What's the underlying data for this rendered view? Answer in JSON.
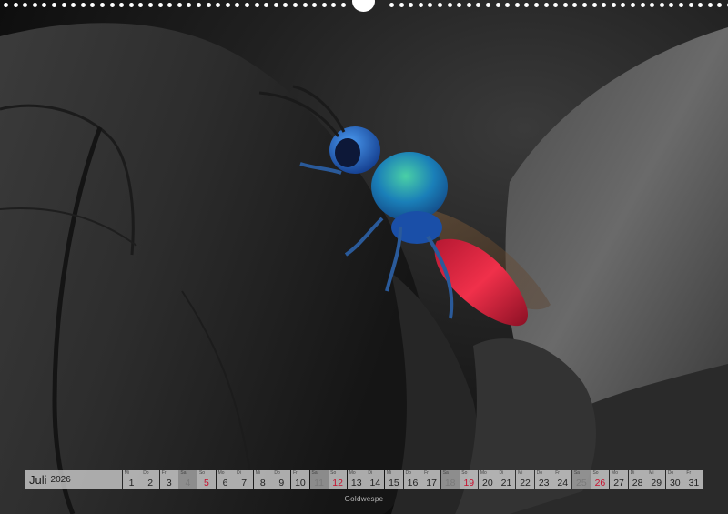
{
  "calendar": {
    "month": "Juli",
    "year": "2026",
    "days": [
      {
        "num": "1",
        "wd": "Mi",
        "type": "normal"
      },
      {
        "num": "2",
        "wd": "Do",
        "type": "normal"
      },
      {
        "num": "3",
        "wd": "Fr",
        "type": "normal"
      },
      {
        "num": "4",
        "wd": "Sa",
        "type": "dim"
      },
      {
        "num": "5",
        "wd": "So",
        "type": "holiday"
      },
      {
        "num": "6",
        "wd": "Mo",
        "type": "normal"
      },
      {
        "num": "7",
        "wd": "Di",
        "type": "normal"
      },
      {
        "num": "8",
        "wd": "Mi",
        "type": "normal"
      },
      {
        "num": "9",
        "wd": "Do",
        "type": "normal"
      },
      {
        "num": "10",
        "wd": "Fr",
        "type": "normal"
      },
      {
        "num": "11",
        "wd": "Sa",
        "type": "dim"
      },
      {
        "num": "12",
        "wd": "So",
        "type": "holiday"
      },
      {
        "num": "13",
        "wd": "Mo",
        "type": "normal"
      },
      {
        "num": "14",
        "wd": "Di",
        "type": "normal"
      },
      {
        "num": "15",
        "wd": "Mi",
        "type": "normal"
      },
      {
        "num": "16",
        "wd": "Do",
        "type": "normal"
      },
      {
        "num": "17",
        "wd": "Fr",
        "type": "normal"
      },
      {
        "num": "18",
        "wd": "Sa",
        "type": "dim"
      },
      {
        "num": "19",
        "wd": "So",
        "type": "holiday"
      },
      {
        "num": "20",
        "wd": "Mo",
        "type": "normal"
      },
      {
        "num": "21",
        "wd": "Di",
        "type": "normal"
      },
      {
        "num": "22",
        "wd": "Mi",
        "type": "normal"
      },
      {
        "num": "23",
        "wd": "Do",
        "type": "normal"
      },
      {
        "num": "24",
        "wd": "Fr",
        "type": "normal"
      },
      {
        "num": "25",
        "wd": "Sa",
        "type": "dim"
      },
      {
        "num": "26",
        "wd": "So",
        "type": "holiday"
      },
      {
        "num": "27",
        "wd": "Mo",
        "type": "normal"
      },
      {
        "num": "28",
        "wd": "Di",
        "type": "normal"
      },
      {
        "num": "29",
        "wd": "Mi",
        "type": "normal"
      },
      {
        "num": "30",
        "wd": "Do",
        "type": "normal"
      },
      {
        "num": "31",
        "wd": "Fr",
        "type": "normal"
      }
    ]
  },
  "caption": "Goldwespe",
  "colors": {
    "holiday": "#c8102e",
    "wasp_head": "#1d5fc8",
    "wasp_thorax": "#1aa3a0",
    "wasp_abdomen": "#e0203a"
  }
}
